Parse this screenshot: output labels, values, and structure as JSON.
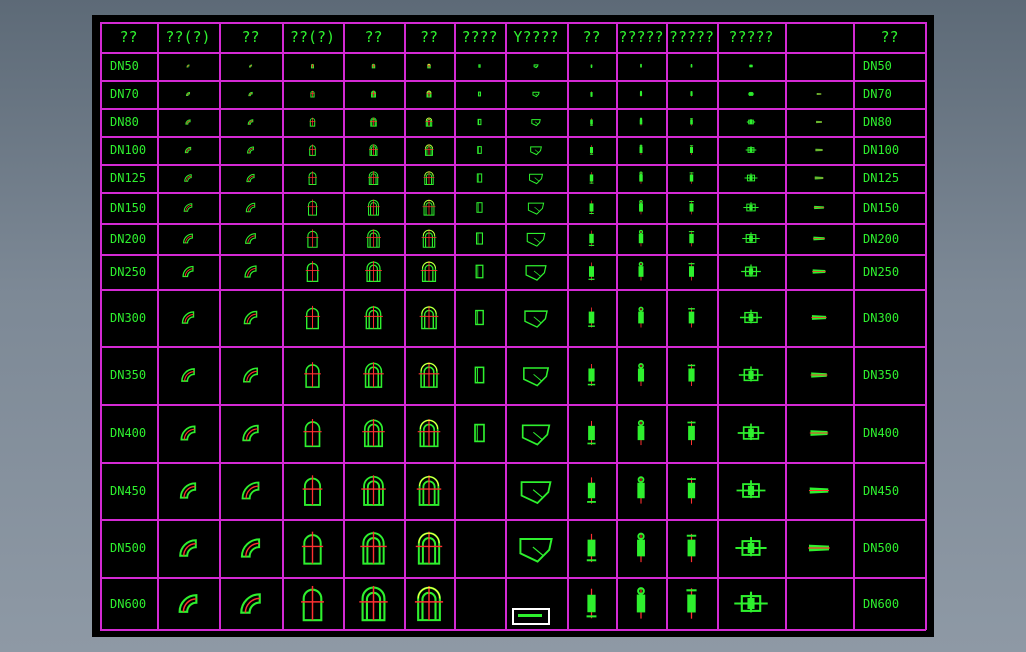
{
  "headers": [
    "??",
    "??(?)",
    "??",
    "??(?)",
    "??",
    "??",
    "????",
    "Y????",
    "??",
    "?????",
    "?????",
    "?????",
    "",
    "??"
  ],
  "sizes": [
    "DN50",
    "DN70",
    "DN80",
    "DN100",
    "DN125",
    "DN150",
    "DN200",
    "DN250",
    "DN300",
    "DN350",
    "DN400",
    "DN450",
    "DN500",
    "DN600"
  ],
  "symbols": [
    "elbow-90",
    "elbow-90-long-radius",
    "cross-tee",
    "reducing-tee",
    "tee-branch",
    "cap",
    "y-strainer",
    "check-valve",
    "gate-valve",
    "globe-valve",
    "butterfly-valve",
    "reducer"
  ],
  "empty_cells": [
    [
      0,
      11
    ],
    [
      5,
      11
    ],
    [
      5,
      12
    ],
    [
      5,
      13
    ],
    [
      11,
      13
    ],
    [
      6,
      13
    ]
  ],
  "colors": {
    "background": "#000000",
    "grid": "#d42ad4",
    "text": "#2ef02e",
    "symbol": "#2ef02e",
    "accent": "#ff3030",
    "highlight": "#ffff40",
    "frame": "#ffffff"
  }
}
